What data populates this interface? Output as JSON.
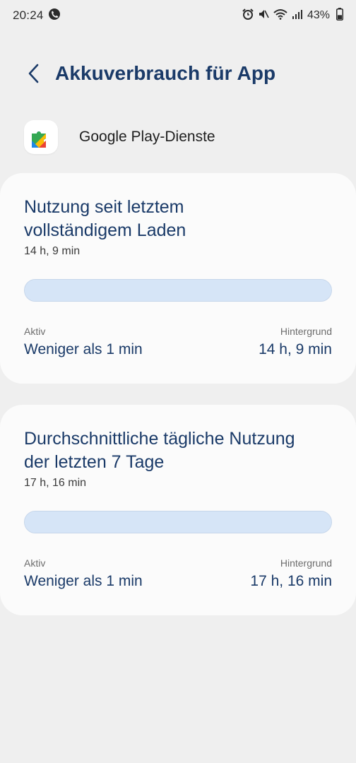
{
  "status_bar": {
    "time": "20:24",
    "battery_percent": "43%",
    "battery_level": 0.43,
    "icons": [
      "call-icon",
      "alarm-icon",
      "mute-icon",
      "wifi-icon",
      "signal-icon",
      "battery-icon"
    ]
  },
  "header": {
    "title": "Akkuverbrauch für App"
  },
  "app": {
    "name": "Google Play-Dienste",
    "icon": "google-play-services-icon"
  },
  "cards": [
    {
      "title_line1": "Nutzung seit letztem",
      "title_line2": "vollständigem Laden",
      "total": "14 h, 9 min",
      "active_label": "Aktiv",
      "active_value": "Weniger als 1 min",
      "background_label": "Hintergrund",
      "background_value": "14 h, 9 min",
      "bar_fill": 1.0
    },
    {
      "title_line1": "Durchschnittliche tägliche Nutzung",
      "title_line2": "der letzten 7 Tage",
      "total": "17 h, 16 min",
      "active_label": "Aktiv",
      "active_value": "Weniger als 1 min",
      "background_label": "Hintergrund",
      "background_value": "17 h, 16 min",
      "bar_fill": 1.0
    }
  ],
  "colors": {
    "accent": "#1a3a68",
    "bar": "#d6e5f7",
    "background": "#efefef",
    "card": "#fbfbfb"
  }
}
